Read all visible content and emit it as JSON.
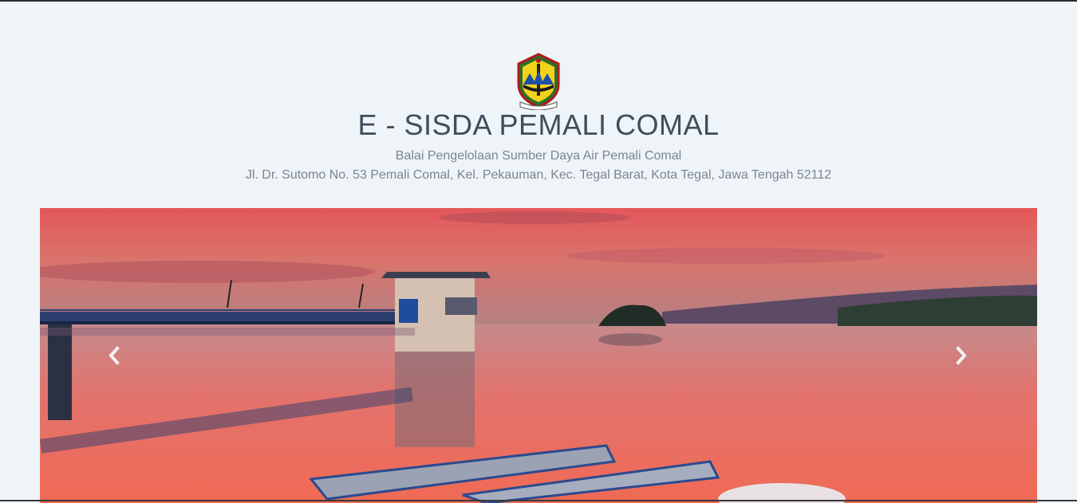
{
  "header": {
    "logo": "jawa-tengah-emblem",
    "title": "E - SISDA PEMALI COMAL",
    "subtitle": "Balai Pengelolaan Sumber Daya Air Pemali Comal",
    "address": "Jl. Dr. Sutomo No. 53 Pemali Comal, Kel. Pekauman, Kec. Tegal Barat, Kota Tegal, Jawa Tengah 52112"
  },
  "carousel": {
    "prev_icon": "chevron-left-icon",
    "next_icon": "chevron-right-icon"
  },
  "colors": {
    "background": "#eef4f8",
    "title": "#3e4e5c",
    "text": "#7a8591"
  }
}
